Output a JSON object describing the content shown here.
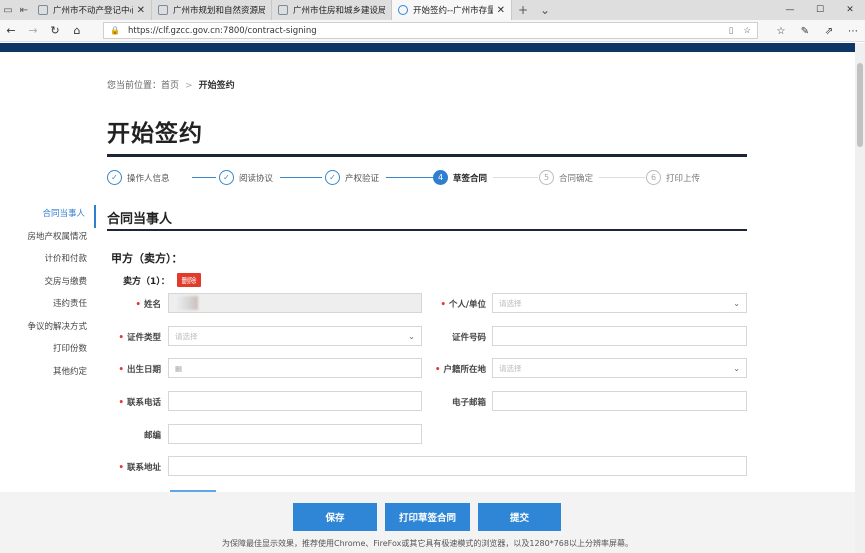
{
  "browser": {
    "tabs": [
      {
        "title": "广州市不动产登记中心_首页"
      },
      {
        "title": "广州市规划和自然资源局网"
      },
      {
        "title": "广州市住房和城乡建设局"
      },
      {
        "title": "开始签约--广州市存量房"
      }
    ],
    "address": "https://clf.gzcc.gov.cn:7800/contract-signing"
  },
  "breadcrumb": {
    "prefix": "您当前位置：",
    "home": "首页",
    "separator": ">",
    "current": "开始签约"
  },
  "page_title": "开始签约",
  "steps": [
    {
      "num": "✓",
      "label": "操作人信息",
      "state": "done"
    },
    {
      "num": "✓",
      "label": "阅读协议",
      "state": "done"
    },
    {
      "num": "✓",
      "label": "产权验证",
      "state": "done"
    },
    {
      "num": "4",
      "label": "草签合同",
      "state": "current"
    },
    {
      "num": "5",
      "label": "合同确定",
      "state": "todo"
    },
    {
      "num": "6",
      "label": "打印上传",
      "state": "todo"
    }
  ],
  "sidebar": {
    "items": [
      {
        "label": "合同当事人",
        "active": true
      },
      {
        "label": "房地产权属情况"
      },
      {
        "label": "计价和付款"
      },
      {
        "label": "交房与缴费"
      },
      {
        "label": "违约责任"
      },
      {
        "label": "争议的解决方式"
      },
      {
        "label": "打印份数"
      },
      {
        "label": "其他约定"
      }
    ]
  },
  "section": {
    "title": "合同当事人",
    "party_title": "甲方（卖方）：",
    "seller_label": "卖方（1）：",
    "delete_label": "删除"
  },
  "form": {
    "name": {
      "label": "姓名",
      "required": true,
      "value": ""
    },
    "person_type": {
      "label": "个人/单位",
      "required": true,
      "placeholder": "请选择"
    },
    "id_type": {
      "label": "证件类型",
      "required": true,
      "placeholder": "请选择"
    },
    "id_number": {
      "label": "证件号码",
      "required": false,
      "value": ""
    },
    "birth_date": {
      "label": "出生日期",
      "required": true,
      "value": ""
    },
    "household": {
      "label": "户籍所在地",
      "required": true,
      "placeholder": "请选择"
    },
    "phone": {
      "label": "联系电话",
      "required": true,
      "value": ""
    },
    "email": {
      "label": "电子邮箱",
      "required": false,
      "value": ""
    },
    "postcode": {
      "label": "邮编",
      "required": false,
      "value": ""
    },
    "address": {
      "label": "联系地址",
      "required": true,
      "value": ""
    }
  },
  "actions": {
    "save": "保存",
    "print": "打印草签合同",
    "submit": "提交"
  },
  "footer_note": "为保障最佳显示效果，推荐使用Chrome、FireFox或其它具有极速模式的浏览器，以及1280*768以上分辨率屏幕。",
  "colors": {
    "primary": "#2f86d6",
    "danger": "#e23b2b",
    "banner": "#0d3566"
  }
}
